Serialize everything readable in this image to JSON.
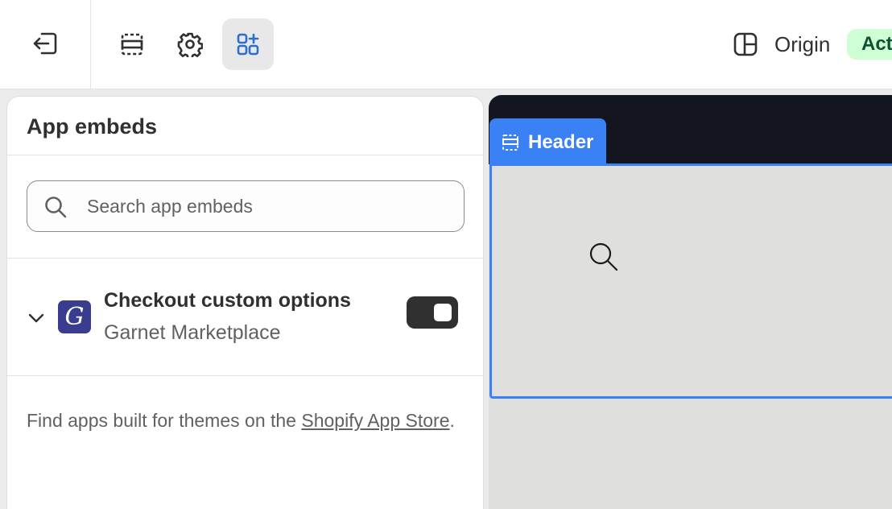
{
  "topbar": {
    "exit_icon": "exit-icon",
    "sections_icon": "sections-icon",
    "settings_icon": "gear-icon",
    "apps_icon": "apps-icon",
    "template_icon": "layout-icon",
    "template_label": "Origin",
    "status_badge": "Active"
  },
  "panel": {
    "title": "App embeds",
    "search": {
      "placeholder": "Search app embeds",
      "value": ""
    },
    "embeds": [
      {
        "name": "Checkout custom options",
        "vendor": "Garnet Marketplace",
        "logo_letter": "G",
        "logo_color": "#3a3d8f",
        "enabled": true
      }
    ],
    "footer": {
      "text_before": "Find apps built for themes on the ",
      "link_text": "Shopify App Store",
      "text_after": "."
    }
  },
  "preview": {
    "section_tag": "Header",
    "accent_color": "#3b81f6"
  }
}
